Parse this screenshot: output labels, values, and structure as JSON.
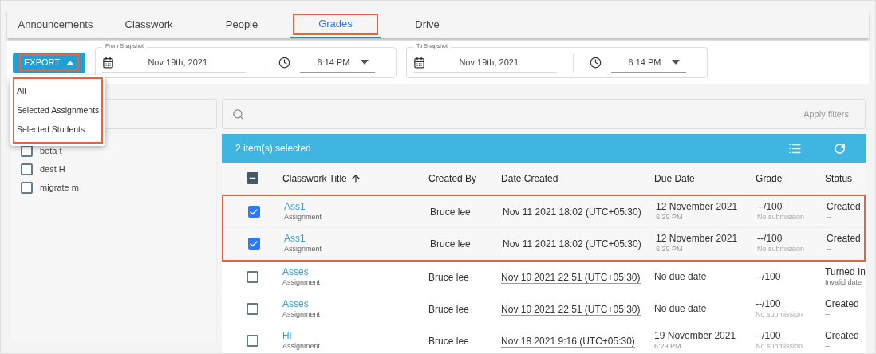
{
  "tabs": [
    {
      "label": "Announcements",
      "selected": false,
      "highlighted": false
    },
    {
      "label": "Classwork",
      "selected": false,
      "highlighted": false
    },
    {
      "label": "People",
      "selected": false,
      "highlighted": false
    },
    {
      "label": "Grades",
      "selected": true,
      "highlighted": true
    },
    {
      "label": "Drive",
      "selected": false,
      "highlighted": false
    }
  ],
  "export": {
    "label": "EXPORT",
    "highlighted": true,
    "expanded": true,
    "menu": {
      "highlighted": true,
      "items": [
        "All",
        "Selected Assignments",
        "Selected Students"
      ]
    }
  },
  "snapshots": [
    {
      "legend": "From Snapshot",
      "date": "Nov 19th, 2021",
      "time": "6:14 PM"
    },
    {
      "legend": "To Snapshot",
      "date": "Nov 19th, 2021",
      "time": "6:14 PM"
    }
  ],
  "students": [
    {
      "name": "beta t",
      "checked": false
    },
    {
      "name": "dest H",
      "checked": false
    },
    {
      "name": "migrate m",
      "checked": false
    }
  ],
  "filter": {
    "button": "Apply filters"
  },
  "table": {
    "selection_text": "2 item(s) selected",
    "select_all_partial": true,
    "columns": [
      "Classwork Title",
      "Created By",
      "Date Created",
      "Due Date",
      "Grade",
      "Status"
    ],
    "rows": [
      {
        "selected": true,
        "highlighted": true,
        "title": "Ass1",
        "type": "Assignment",
        "created_by": "Bruce lee",
        "date_created": "Nov 11 2021 18:02 (UTC+05:30)",
        "due_date": "12 November 2021",
        "due_time": "6:29 PM",
        "grade": "--/100",
        "grade_note": "No submission",
        "status": "Created",
        "status_note": "--"
      },
      {
        "selected": true,
        "highlighted": true,
        "title": "Ass1",
        "type": "Assignment",
        "created_by": "Bruce lee",
        "date_created": "Nov 11 2021 18:02 (UTC+05:30)",
        "due_date": "12 November 2021",
        "due_time": "6:29 PM",
        "grade": "--/100",
        "grade_note": "No submission",
        "status": "Created",
        "status_note": "--"
      },
      {
        "selected": false,
        "highlighted": false,
        "title": "Asses",
        "type": "Assignment",
        "created_by": "Bruce lee",
        "date_created": "Nov 10 2021 22:51 (UTC+05:30)",
        "due_date": "No due date",
        "grade": "--/100",
        "status": "Turned In",
        "status_note": "Invalid date"
      },
      {
        "selected": false,
        "highlighted": false,
        "title": "Asses",
        "type": "Assignment",
        "created_by": "Bruce lee",
        "date_created": "Nov 10 2021 22:51 (UTC+05:30)",
        "due_date": "No due date",
        "grade": "--/100",
        "grade_note": "No submission",
        "status": "Created",
        "status_note": "--"
      },
      {
        "selected": false,
        "highlighted": false,
        "title": "Hi",
        "type": "Assignment",
        "created_by": "Bruce lee",
        "date_created": "Nov 18 2021 9:16 (UTC+05:30)",
        "due_date": "19 November 2021",
        "due_time": "6:29 PM",
        "grade": "--/100",
        "grade_note": "No submission",
        "status": "Created",
        "status_note": "--"
      }
    ]
  }
}
